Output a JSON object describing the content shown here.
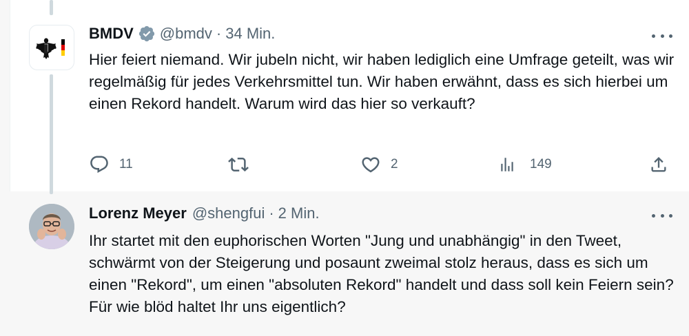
{
  "tweets": [
    {
      "name": "BMDV",
      "handle": "@bmdv",
      "time": "34 Min.",
      "verified": true,
      "text": "Hier feiert niemand. Wir jubeln nicht, wir haben lediglich eine Umfrage geteilt, was wir regelmäßig für jedes Verkehrsmittel tun. Wir haben erwähnt, dass es sich hierbei um einen Rekord handelt. Warum wird das hier so verkauft?",
      "replies": "11",
      "retweets": "",
      "likes": "2",
      "views": "149"
    },
    {
      "name": "Lorenz Meyer",
      "handle": "@shengfui",
      "time": "2 Min.",
      "text": "Ihr startet mit den euphorischen Worten \"Jung und unabhängig\" in den Tweet, schwärmt von der Steigerung und posaunt zweimal stolz heraus, dass es sich um einen \"Rekord\", um einen \"absoluten Rekord\" handelt und dass soll kein Feiern sein? Für wie blöd haltet Ihr uns eigentlich?"
    }
  ],
  "separator": "·",
  "colors": {
    "text": "#0f1419",
    "muted": "#536471",
    "verified": "#829aab",
    "thread_line": "#cfd9de"
  },
  "icons": [
    "reply-icon",
    "retweet-icon",
    "like-icon",
    "views-icon",
    "share-icon",
    "verified-badge-icon",
    "more-icon"
  ]
}
